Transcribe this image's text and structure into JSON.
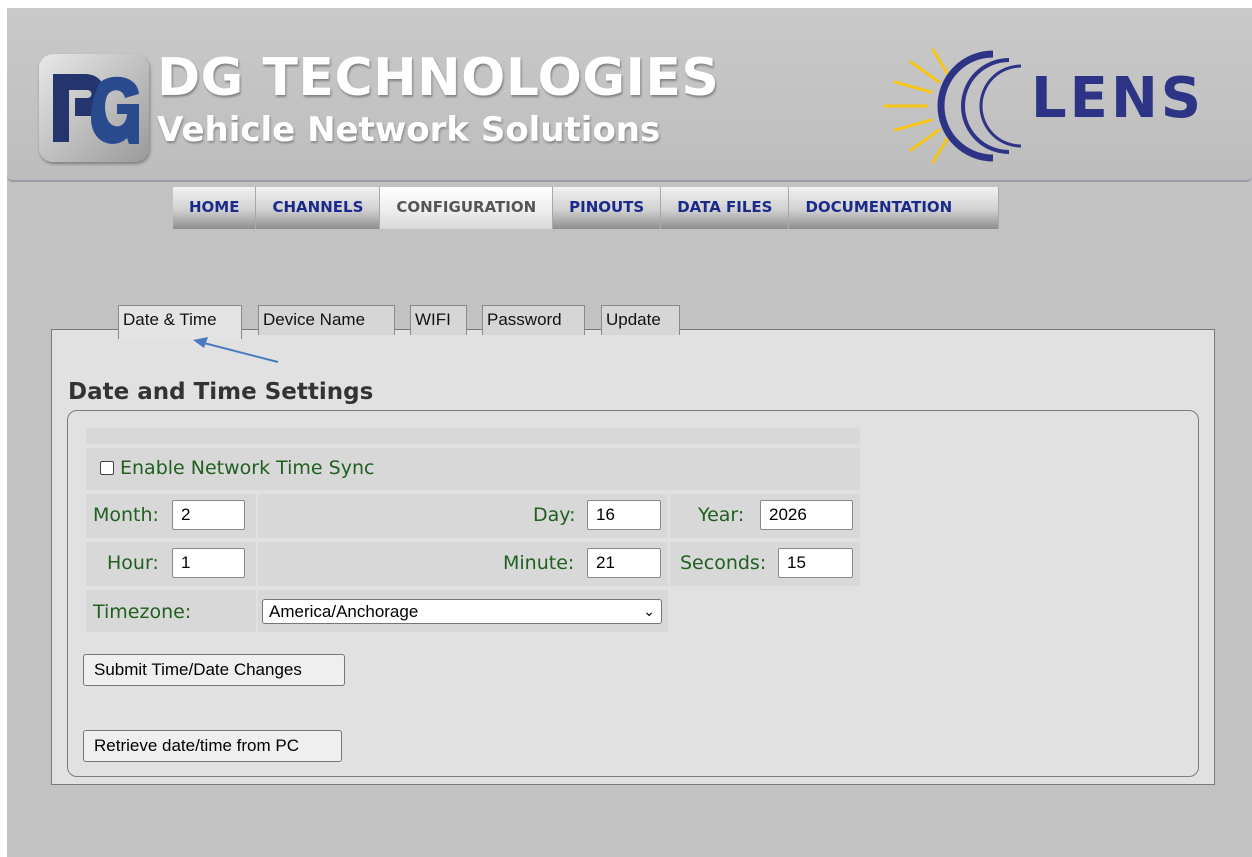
{
  "header": {
    "brand_title": "DG TECHNOLOGIES",
    "brand_subtitle": "Vehicle Network Solutions",
    "lens_logo_text": "LENS"
  },
  "nav": {
    "items": [
      {
        "label": "HOME",
        "active": false
      },
      {
        "label": "CHANNELS",
        "active": false
      },
      {
        "label": "CONFIGURATION",
        "active": true
      },
      {
        "label": "PINOUTS",
        "active": false
      },
      {
        "label": "DATA FILES",
        "active": false
      },
      {
        "label": "DOCUMENTATION",
        "active": false
      }
    ]
  },
  "tabs": {
    "items": [
      {
        "label": "Date & Time",
        "active": true
      },
      {
        "label": "Device Name",
        "active": false
      },
      {
        "label": "WIFI",
        "active": false
      },
      {
        "label": "Password",
        "active": false
      },
      {
        "label": "Update",
        "active": false
      }
    ]
  },
  "settings": {
    "title": "Date and Time Settings",
    "ntp_label": "Enable Network Time Sync",
    "ntp_checked": false,
    "month_label": "Month:",
    "month_value": "2",
    "day_label": "Day:",
    "day_value": "16",
    "year_label": "Year:",
    "year_value": "2026",
    "hour_label": "Hour:",
    "hour_value": "1",
    "minute_label": "Minute:",
    "minute_value": "21",
    "seconds_label": "Seconds:",
    "seconds_value": "15",
    "timezone_label": "Timezone:",
    "timezone_value": "America/Anchorage",
    "submit_button": "Submit Time/Date Changes",
    "retrieve_button": "Retrieve date/time from PC"
  },
  "colors": {
    "nav_text": "#1a2a8a",
    "label_green": "#1f5f1f",
    "lens_blue": "#2d3486",
    "lens_sun": "#f5c518",
    "arrow": "#4a7bc0"
  }
}
